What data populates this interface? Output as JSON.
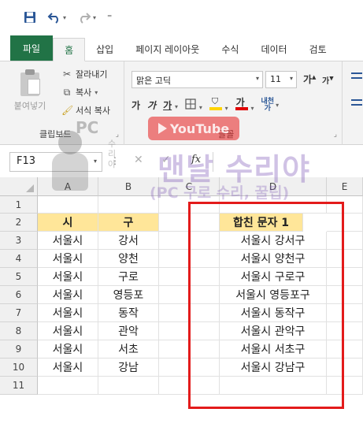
{
  "qat": {
    "save_icon": "save-icon",
    "undo_icon": "undo-icon",
    "redo_icon": "redo-icon",
    "customize_glyph": "⁼"
  },
  "tabs": [
    {
      "label": "파일"
    },
    {
      "label": "홈"
    },
    {
      "label": "삽입"
    },
    {
      "label": "페이지 레이아웃"
    },
    {
      "label": "수식"
    },
    {
      "label": "데이터"
    },
    {
      "label": "검토"
    }
  ],
  "clipboard": {
    "paste_label": "붙여넣기",
    "cut_label": "잘라내기",
    "copy_label": "복사",
    "format_painter_label": "서식 복사",
    "group_label": "클립보드"
  },
  "font": {
    "name": "맑은 고딕",
    "size": "11",
    "grow": "가",
    "shrink": "가",
    "bold": "가",
    "italic": "가",
    "underline": "가",
    "font_color_glyph": "가",
    "ruby_top": "내천",
    "ruby_bottom": "가",
    "group_label": "글꼴",
    "fill_color": "#ffd400",
    "text_color": "#e00000"
  },
  "watermark": {
    "pc": "PC",
    "youtube": "YouTube",
    "channel": "맨날 수리야",
    "subtitle": "(PC 구로 수리, 꿀팁)",
    "vertical": "수리야"
  },
  "formula_bar": {
    "name_box": "F13",
    "cancel": "✕",
    "enter": "✓",
    "fx": "fx",
    "value": ""
  },
  "grid": {
    "columns": [
      "A",
      "B",
      "C",
      "D",
      "E"
    ],
    "rows": [
      "1",
      "2",
      "3",
      "4",
      "5",
      "6",
      "7",
      "8",
      "9",
      "10",
      "11"
    ],
    "header_row": {
      "A": "시",
      "B": "구",
      "D": "합친 문자 1"
    },
    "data": [
      {
        "A": "서울시",
        "B": "강서",
        "D": "서울시 강서구"
      },
      {
        "A": "서울시",
        "B": "양천",
        "D": "서울시 양천구"
      },
      {
        "A": "서울시",
        "B": "구로",
        "D": "서울시 구로구"
      },
      {
        "A": "서울시",
        "B": "영등포",
        "D": "서울시 영등포구"
      },
      {
        "A": "서울시",
        "B": "동작",
        "D": "서울시 동작구"
      },
      {
        "A": "서울시",
        "B": "관악",
        "D": "서울시 관악구"
      },
      {
        "A": "서울시",
        "B": "서초",
        "D": "서울시 서초구"
      },
      {
        "A": "서울시",
        "B": "강남",
        "D": "서울시 강남구"
      }
    ],
    "header_fill": "#ffe699",
    "highlight_color": "#e31b1b"
  }
}
